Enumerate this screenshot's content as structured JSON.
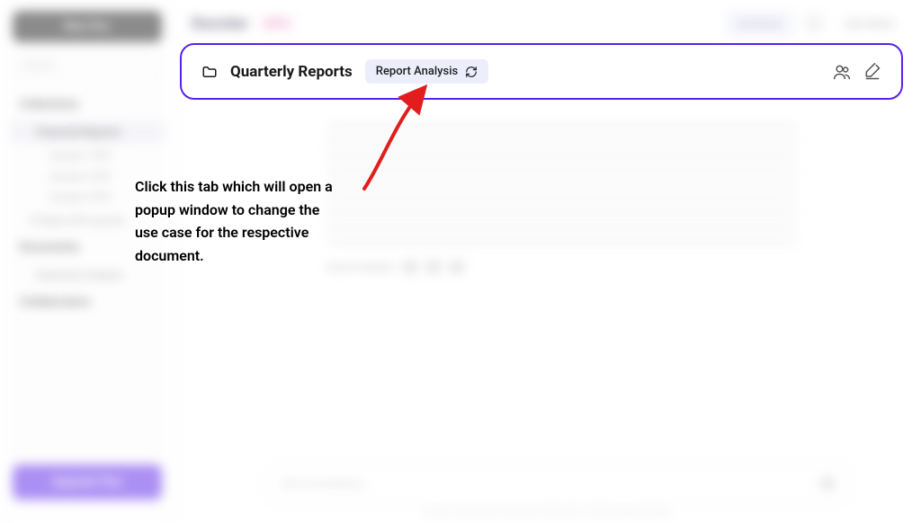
{
  "sidebar": {
    "logo_label": "New Doc",
    "search_placeholder": "Search",
    "section_collections": "Collections",
    "items": [
      {
        "label": "Financial Reports",
        "active": true
      },
      {
        "label": "Sample 1 PDF"
      },
      {
        "label": "Sample 2 PDF"
      },
      {
        "label": "Sample 3 PDF"
      }
    ],
    "item_10days": "10 Days Left to go pro",
    "section_demonstrate": "Documents",
    "item_demonstrate_sub": "Quarterly Analysis",
    "section_collab": "Collaborators",
    "upgrade_label": "Upgrade Plan"
  },
  "topbar": {
    "brand": "Docster",
    "badge": "BETA",
    "download_label": "Download",
    "settings_icon": "gear-icon",
    "user_label": "User Name"
  },
  "header": {
    "title": "Quarterly Reports",
    "usecase_label": "Report Analysis"
  },
  "callout": {
    "text": "Click this tab which will open a popup window to change the use case for the respective document."
  },
  "chat": {
    "action_label": "Send Feedback",
    "input_placeholder": "Ask me anything...",
    "footer": "Docster may produce inaccurate information. Verify important details."
  }
}
